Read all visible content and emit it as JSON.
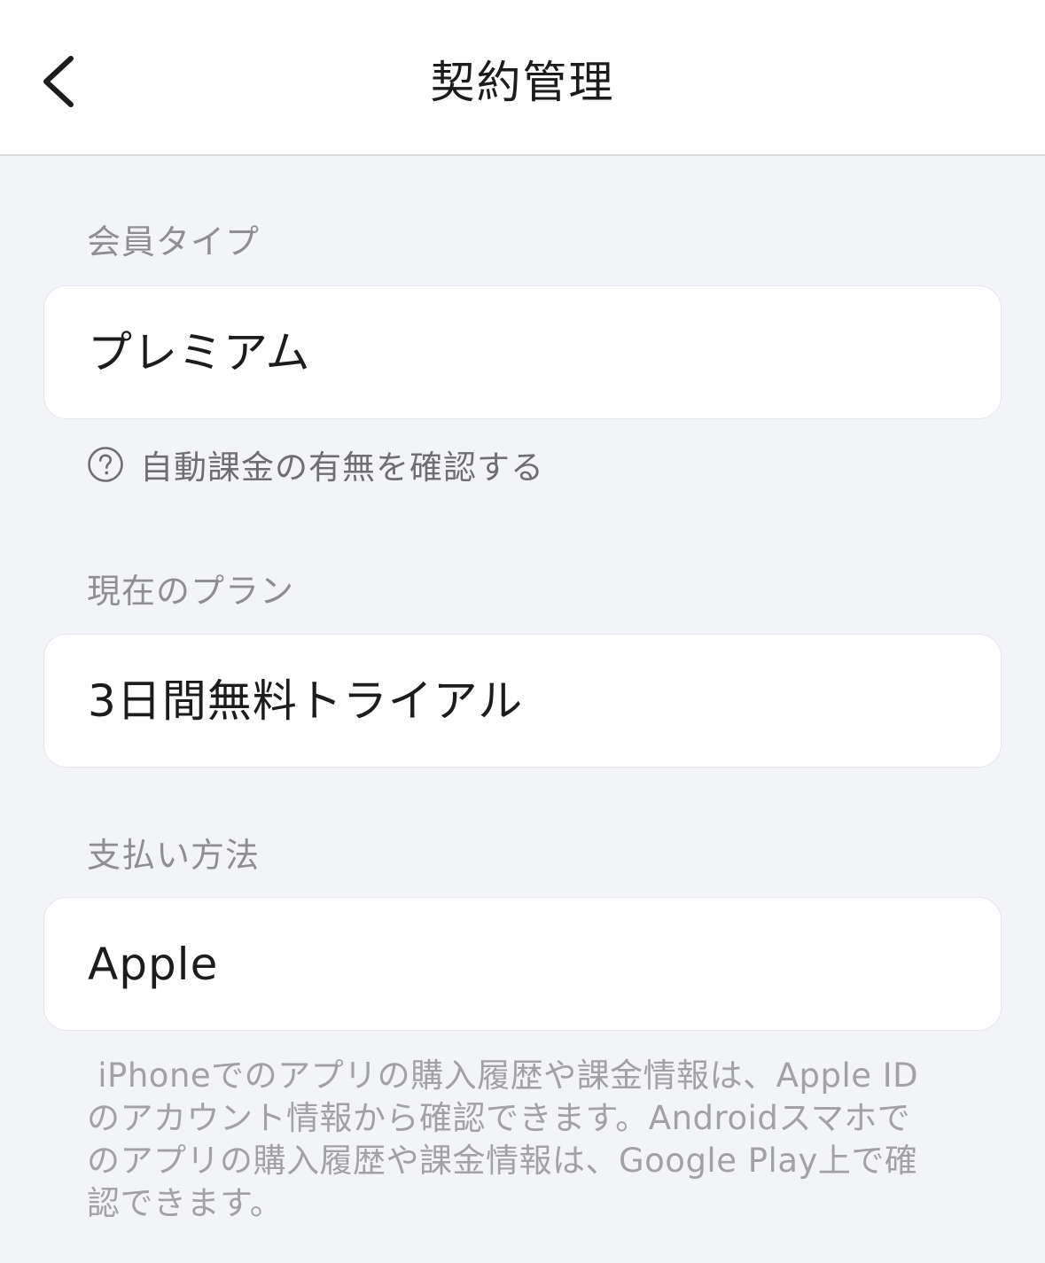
{
  "header": {
    "title": "契約管理",
    "back_icon": "chevron-left-icon"
  },
  "membership": {
    "label": "会員タイプ",
    "value": "プレミアム",
    "help_icon": "question-circle-icon",
    "help_text": "自動課金の有無を確認する"
  },
  "plan": {
    "label": "現在のプラン",
    "value": "3日間無料トライアル"
  },
  "payment": {
    "label": "支払い方法",
    "value": "Apple"
  },
  "note": {
    "text": " iPhoneでのアプリの購入履歴や課金情報は、Apple ID\nのアカウント情報から確認できます。Androidスマホで\nのアプリの購入履歴や課金情報は、Google Play上で確\n認できます。"
  },
  "colors": {
    "background": "#f3f4f8",
    "card": "#ffffff",
    "label": "#8e8e93",
    "text": "#1c1c1e",
    "note": "#a1a1a6"
  }
}
